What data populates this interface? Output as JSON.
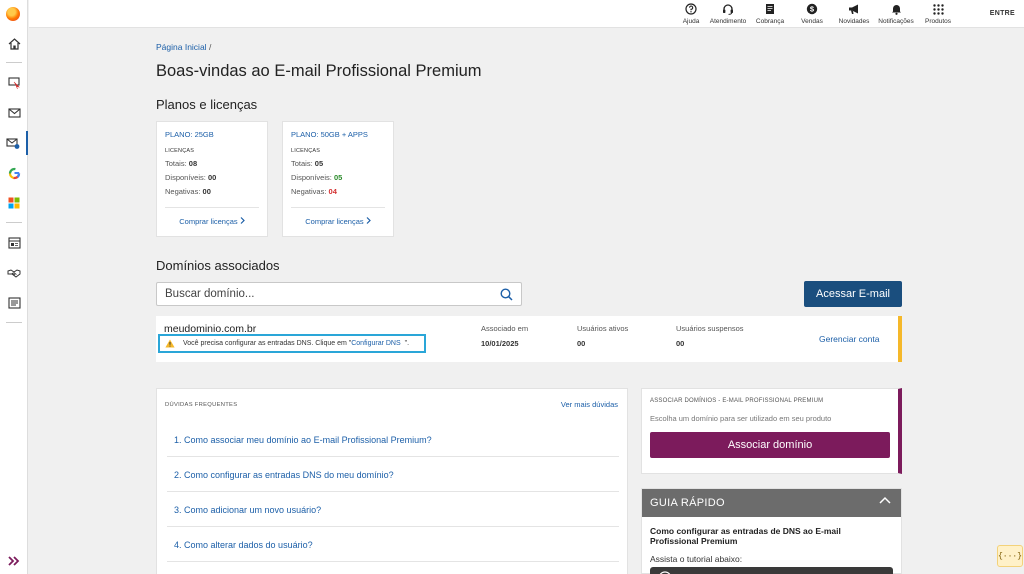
{
  "colors": {
    "link": "#1c5fa8",
    "primary_button": "#1a4e7e",
    "associate_button": "#7c1b5c",
    "warning_accent": "#f5b82a",
    "highlight_border": "#2aa6d8"
  },
  "sidebar": {
    "items": [
      {
        "icon": "home-icon"
      },
      {
        "icon": "monitor-cursor-icon"
      },
      {
        "icon": "envelope-icon"
      },
      {
        "icon": "professional-email-icon",
        "active": true
      },
      {
        "icon": "google-icon"
      },
      {
        "icon": "microsoft-icon"
      },
      {
        "icon": "website-builder-icon"
      },
      {
        "icon": "handshake-icon"
      },
      {
        "icon": "billing-list-icon"
      }
    ],
    "collapse_icon": "double-chevron-right-icon"
  },
  "topbar": {
    "nav": [
      {
        "label": "Ajuda",
        "icon": "help-icon"
      },
      {
        "label": "Atendimento",
        "icon": "headset-icon"
      },
      {
        "label": "Cobrança",
        "icon": "document-icon"
      },
      {
        "label": "Vendas",
        "icon": "dollar-bag-icon"
      },
      {
        "label": "Novidades",
        "icon": "megaphone-icon"
      },
      {
        "label": "Notificações",
        "icon": "bell-icon"
      },
      {
        "label": "Produtos",
        "icon": "grid-icon"
      }
    ],
    "login": "ENTRE"
  },
  "breadcrumb": {
    "home": "Página Inicial",
    "separator": "/"
  },
  "page_title": "Boas-vindas ao E-mail Profissional Premium",
  "plans": {
    "title": "Planos e licenças",
    "licenses_label": "LICENÇAS",
    "total_label": "Totais:",
    "available_label": "Disponíveis:",
    "negative_label": "Negativas:",
    "buy_label": "Comprar licenças",
    "cards": [
      {
        "name": "PLANO: 25GB",
        "total": "08",
        "available": "00",
        "negative": "00"
      },
      {
        "name": "PLANO: 50GB + APPS",
        "total": "05",
        "available": "05",
        "negative": "04"
      }
    ]
  },
  "domains": {
    "title": "Domínios associados",
    "search_placeholder": "Buscar domínio...",
    "access_button": "Acessar E-mail",
    "row": {
      "domain": "meudominio.com.br",
      "warning_text": "Você precisa configurar as entradas DNS. Clique em \"",
      "warning_link": "Configurar DNS",
      "warning_end": "\".",
      "associated_label": "Associado em",
      "associated_value": "10/01/2025",
      "active_users_label": "Usuários ativos",
      "active_users_value": "00",
      "suspended_users_label": "Usuários suspensos",
      "suspended_users_value": "00",
      "manage": "Gerenciar conta"
    }
  },
  "faq": {
    "title": "DÚVIDAS FREQUENTES",
    "more": "Ver mais dúvidas",
    "items": [
      "1. Como associar meu domínio ao E-mail Profissional Premium?",
      "2. Como configurar as entradas DNS do meu domínio?",
      "3. Como adicionar um novo usuário?",
      "4. Como alterar dados do usuário?"
    ]
  },
  "associate": {
    "title": "ASSOCIAR DOMÍNIOS - E-MAIL PROFISSIONAL PREMIUM",
    "subtitle": "Escolha um domínio para ser utilizado em seu produto",
    "button": "Associar domínio"
  },
  "guide": {
    "title": "GUIA RÁPIDO",
    "heading": "Como configurar as entradas de DNS ao E-mail Profissional Premium",
    "text": "Assista o tutorial abaixo:"
  },
  "dev_badge": "{···}"
}
